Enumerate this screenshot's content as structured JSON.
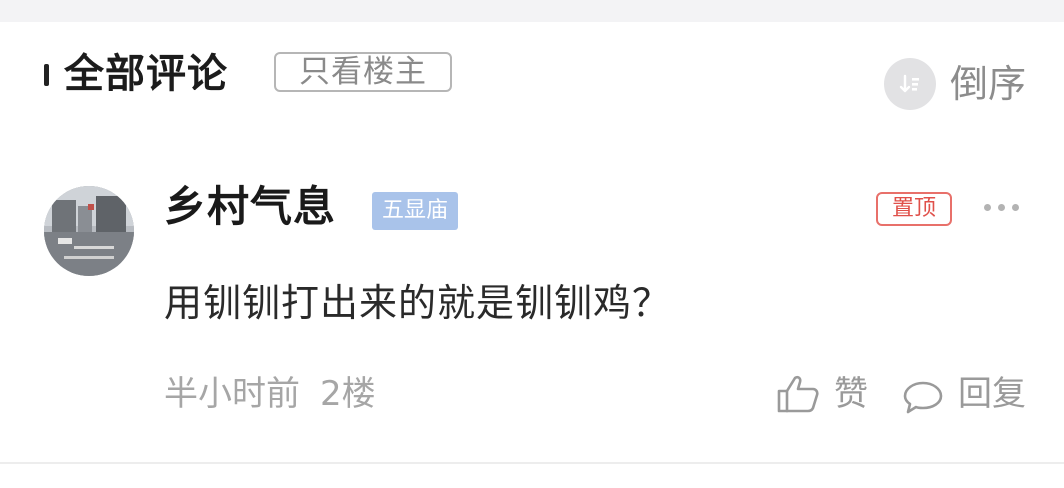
{
  "header": {
    "title": "全部评论",
    "filter_label": "只看楼主",
    "sort_label": "倒序",
    "sort_icon": "sort-icon"
  },
  "comment": {
    "username": "乡村气息",
    "badge": "五显庙",
    "pin_label": "置顶",
    "text": "用钏钏打出来的就是钏钏鸡？",
    "time": "半小时前",
    "floor": "2楼",
    "like_label": "赞",
    "reply_label": "回复"
  },
  "colors": {
    "badge_bg": "#a9c3ea",
    "pin_red": "#e0504a",
    "muted_text": "#a6a6a6"
  }
}
